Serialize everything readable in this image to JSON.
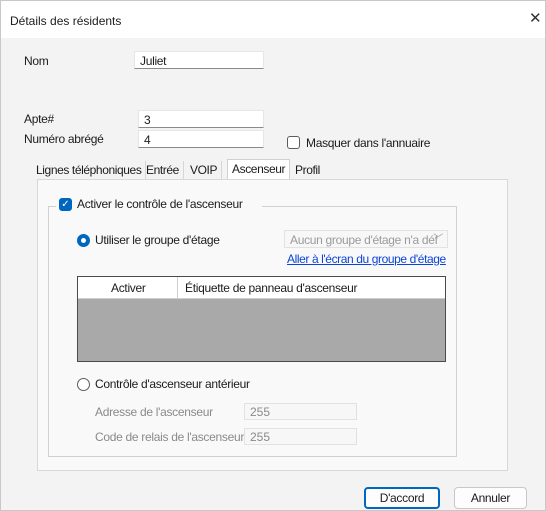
{
  "dialog": {
    "title": "Détails des résidents",
    "close_glyph": "✕"
  },
  "form": {
    "name_label": "Nom",
    "name_value": "Juliet",
    "apt_label": "Apte#",
    "apt_value": "3",
    "short_label": "Numéro abrégé",
    "short_value": "4",
    "hide_label": "Masquer dans l'annuaire",
    "hide_checked": false
  },
  "tabs": [
    {
      "label": "Lignes téléphoniques",
      "active": false
    },
    {
      "label": "Entrée",
      "active": false
    },
    {
      "label": "VOIP",
      "active": false
    },
    {
      "label": "Ascenseur",
      "active": true
    },
    {
      "label": "Profil",
      "active": false
    }
  ],
  "elevator": {
    "enable_label": "Activer le contrôle de l'ascenseur",
    "enable_checked": true,
    "floor_group_label": "Utiliser le groupe d'étage",
    "floor_group_selected": true,
    "floor_group_combo": "Aucun groupe d'étage n'a déf",
    "floor_group_link": "Aller à l'écran du groupe d'étage",
    "table_headers": [
      "Activer",
      "Étiquette de panneau d'ascenseur"
    ],
    "legacy_label": "Contrôle d'ascenseur antérieur",
    "address_label": "Adresse de l'ascenseur",
    "address_value": "255",
    "relay_label": "Code de relais de l'ascenseur",
    "relay_value": "255"
  },
  "buttons": {
    "ok": "D'accord",
    "cancel": "Annuler"
  }
}
